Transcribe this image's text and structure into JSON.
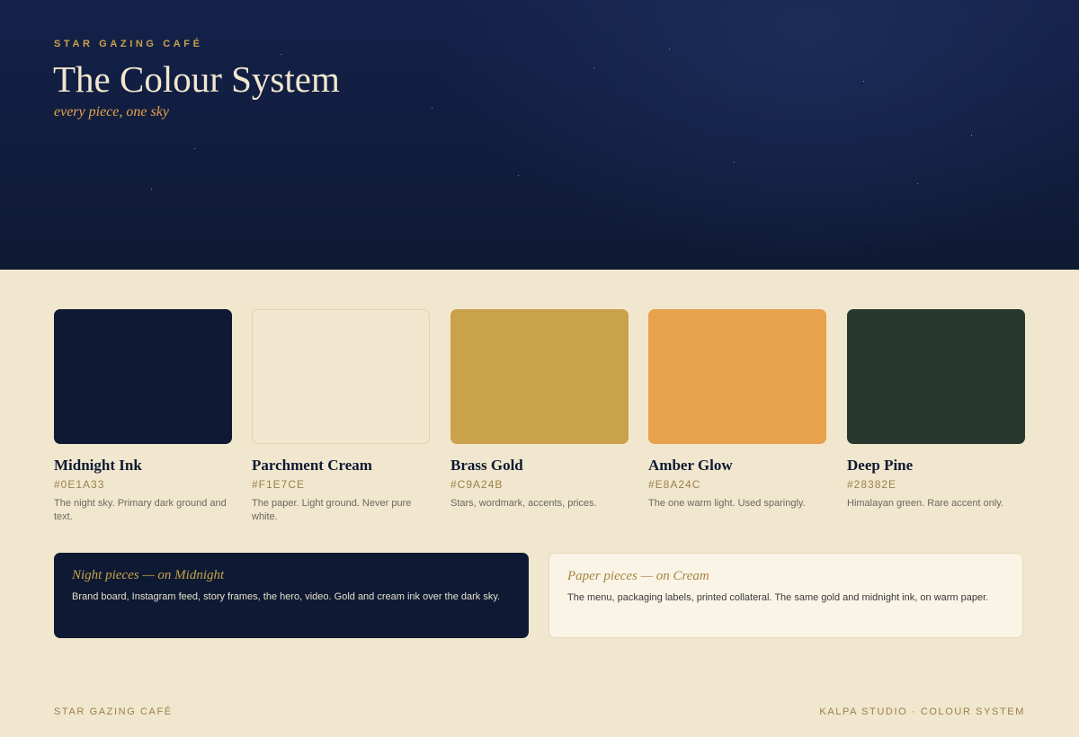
{
  "hero": {
    "eyebrow": "STAR GAZING CAFÉ",
    "title": "The Colour System",
    "subtitle": "every piece, one sky"
  },
  "swatches": [
    {
      "name": "Midnight Ink",
      "hex": "#0E1A33",
      "desc": "The night sky. Primary dark ground and text.",
      "color": "#0E1A33"
    },
    {
      "name": "Parchment Cream",
      "hex": "#F1E7CE",
      "desc": "The paper. Light ground. Never pure white.",
      "color": "#F1E7CE"
    },
    {
      "name": "Brass Gold",
      "hex": "#C9A24B",
      "desc": "Stars, wordmark, accents, prices.",
      "color": "#C9A24B"
    },
    {
      "name": "Amber Glow",
      "hex": "#E8A24C",
      "desc": "The one warm light. Used sparingly.",
      "color": "#E8A24C"
    },
    {
      "name": "Deep Pine",
      "hex": "#28382E",
      "desc": "Himalayan green. Rare accent only.",
      "color": "#28382E"
    }
  ],
  "usage": {
    "night": {
      "title": "Night pieces — on Midnight",
      "text": "Brand board, Instagram feed, story frames, the hero, video. Gold and cream ink over the dark sky."
    },
    "paper": {
      "title": "Paper pieces — on Cream",
      "text": "The menu, packaging labels, printed collateral. The same gold and midnight ink, on warm paper."
    }
  },
  "footer": {
    "left": "STAR GAZING CAFÉ",
    "right": "KALPA STUDIO · COLOUR SYSTEM"
  }
}
